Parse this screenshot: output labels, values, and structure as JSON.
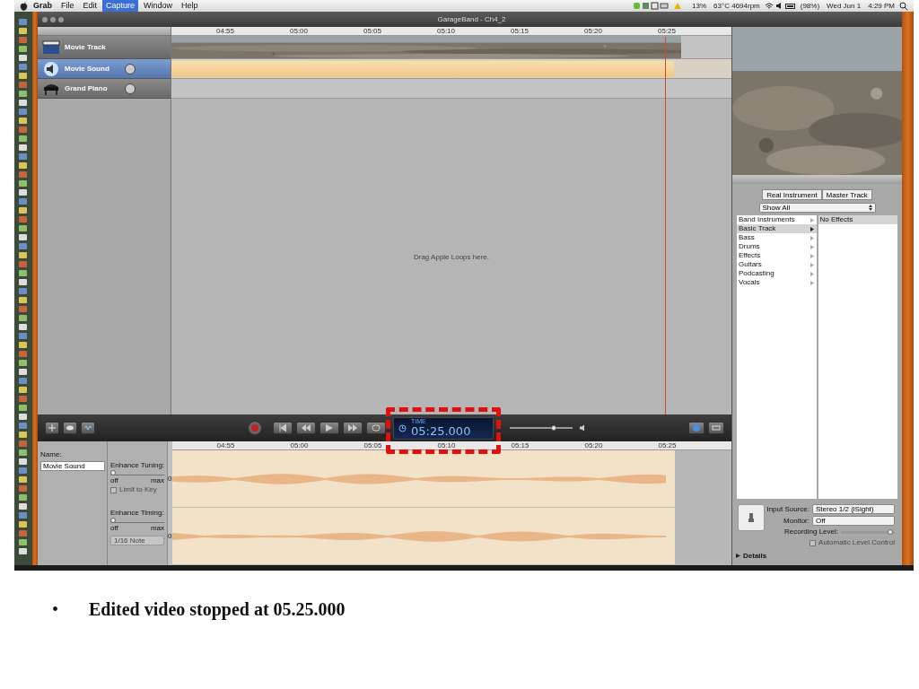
{
  "menu_bar": {
    "items": [
      {
        "label": "Grab",
        "selected": false
      },
      {
        "label": "File",
        "selected": false
      },
      {
        "label": "Edit",
        "selected": false
      },
      {
        "label": "Capture",
        "selected": true
      },
      {
        "label": "Window",
        "selected": false
      },
      {
        "label": "Help",
        "selected": false
      }
    ],
    "status": [
      "13%",
      "63°C 4694rpm",
      "(98%)",
      "Wed Jun 1",
      "4:29 PM"
    ]
  },
  "window": {
    "title": "GarageBand - Ch4_2"
  },
  "tracks": [
    {
      "name": "Movie Track",
      "kind": "movie",
      "selected": false
    },
    {
      "name": "Movie Sound",
      "kind": "audio",
      "selected": true
    },
    {
      "name": "Grand Piano",
      "kind": "instrument",
      "selected": false
    }
  ],
  "ruler": [
    "04:55",
    "05:00",
    "05:05",
    "05:10",
    "05:15",
    "05:20",
    "05:25"
  ],
  "drop_hint": "Drag Apple Loops here.",
  "transport": {
    "lcd_label": "TIME",
    "lcd_value": "05:25.000",
    "volume": {
      "level": 0.65
    }
  },
  "editor": {
    "ruler": [
      "04:55",
      "05:00",
      "05:05",
      "05:10",
      "05:15",
      "05:20",
      "05:25"
    ],
    "name_label": "Name:",
    "name_value": "Movie Sound",
    "sliders": [
      {
        "label": "Enhance Tuning:",
        "min": "off",
        "max": "max",
        "level": 0
      },
      {
        "label": "Enhance Timing:",
        "min": "off",
        "max": "max",
        "level": 0
      }
    ],
    "limit_to_key": {
      "label": "Limit to Key",
      "checked": false,
      "disabled": true
    },
    "note_select": "1/16 Note",
    "axis_labels": [
      "0",
      "0"
    ]
  },
  "right_panel": {
    "buttons": [
      "Real Instrument",
      "Master Track"
    ],
    "filter": "Show All",
    "categories": [
      {
        "label": "Band Instruments",
        "selected": false
      },
      {
        "label": "Basic Track",
        "selected": true
      },
      {
        "label": "Bass",
        "selected": false
      },
      {
        "label": "Drums",
        "selected": false
      },
      {
        "label": "Effects",
        "selected": false
      },
      {
        "label": "Guitars",
        "selected": false
      },
      {
        "label": "Podcasting",
        "selected": false
      },
      {
        "label": "Vocals",
        "selected": false
      }
    ],
    "effects": [
      {
        "label": "No Effects",
        "selected": true
      }
    ],
    "fields": [
      {
        "label": "Input Source:",
        "value": "Stereo 1/2 (iSight)"
      },
      {
        "label": "Monitor:",
        "value": "Off"
      }
    ],
    "recording_level": {
      "label": "Recording Level:",
      "level": 0.95
    },
    "auto_level": {
      "label": "Automatic Level Control",
      "checked": false,
      "disabled": true
    },
    "details": {
      "label": "Details",
      "expanded": false
    }
  },
  "caption": {
    "bullet": "•",
    "text": "Edited video stopped at 05.25.000"
  }
}
